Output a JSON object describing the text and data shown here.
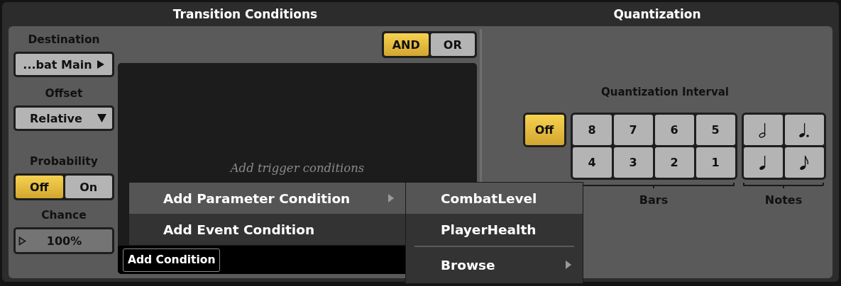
{
  "transition_conditions": {
    "title": "Transition Conditions",
    "destination": {
      "label": "Destination",
      "value": "...bat Main"
    },
    "offset": {
      "label": "Offset",
      "value": "Relative"
    },
    "probability": {
      "label": "Probability",
      "options": [
        {
          "label": "Off",
          "selected": true
        },
        {
          "label": "On",
          "selected": false
        }
      ]
    },
    "chance": {
      "label": "Chance",
      "value": "100%",
      "level": 1
    },
    "logic": [
      {
        "label": "AND",
        "selected": true
      },
      {
        "label": "OR",
        "selected": false
      }
    ],
    "placeholder": "Add trigger conditions",
    "add_condition": "Add Condition"
  },
  "context_menu": {
    "items": [
      {
        "label": "Add Parameter Condition",
        "selected": true,
        "submenu": true
      },
      {
        "label": "Add Event Condition",
        "selected": false,
        "submenu": false
      }
    ]
  },
  "submenu": {
    "items": [
      {
        "kind": "item",
        "label": "CombatLevel",
        "selected": true,
        "submenu": false
      },
      {
        "kind": "item",
        "label": "PlayerHealth",
        "selected": false,
        "submenu": false
      },
      {
        "kind": "separator"
      },
      {
        "kind": "item",
        "label": "Browse",
        "selected": false,
        "submenu": true
      }
    ]
  },
  "quantization": {
    "title": "Quantization",
    "interval_label": "Quantization Interval",
    "off": {
      "label": "Off",
      "selected": true
    },
    "bars": [
      {
        "label": "8",
        "selected": false
      },
      {
        "label": "7",
        "selected": false
      },
      {
        "label": "6",
        "selected": false
      },
      {
        "label": "5",
        "selected": false
      },
      {
        "label": "4",
        "selected": false
      },
      {
        "label": "3",
        "selected": false
      },
      {
        "label": "2",
        "selected": false
      },
      {
        "label": "1",
        "selected": false
      }
    ],
    "bars_label": "Bars",
    "notes": [
      {
        "kind": "half",
        "selected": false
      },
      {
        "kind": "dotted_quarter",
        "selected": false
      },
      {
        "kind": "quarter",
        "selected": false
      },
      {
        "kind": "eighth",
        "selected": false
      }
    ],
    "notes_label": "Notes"
  }
}
